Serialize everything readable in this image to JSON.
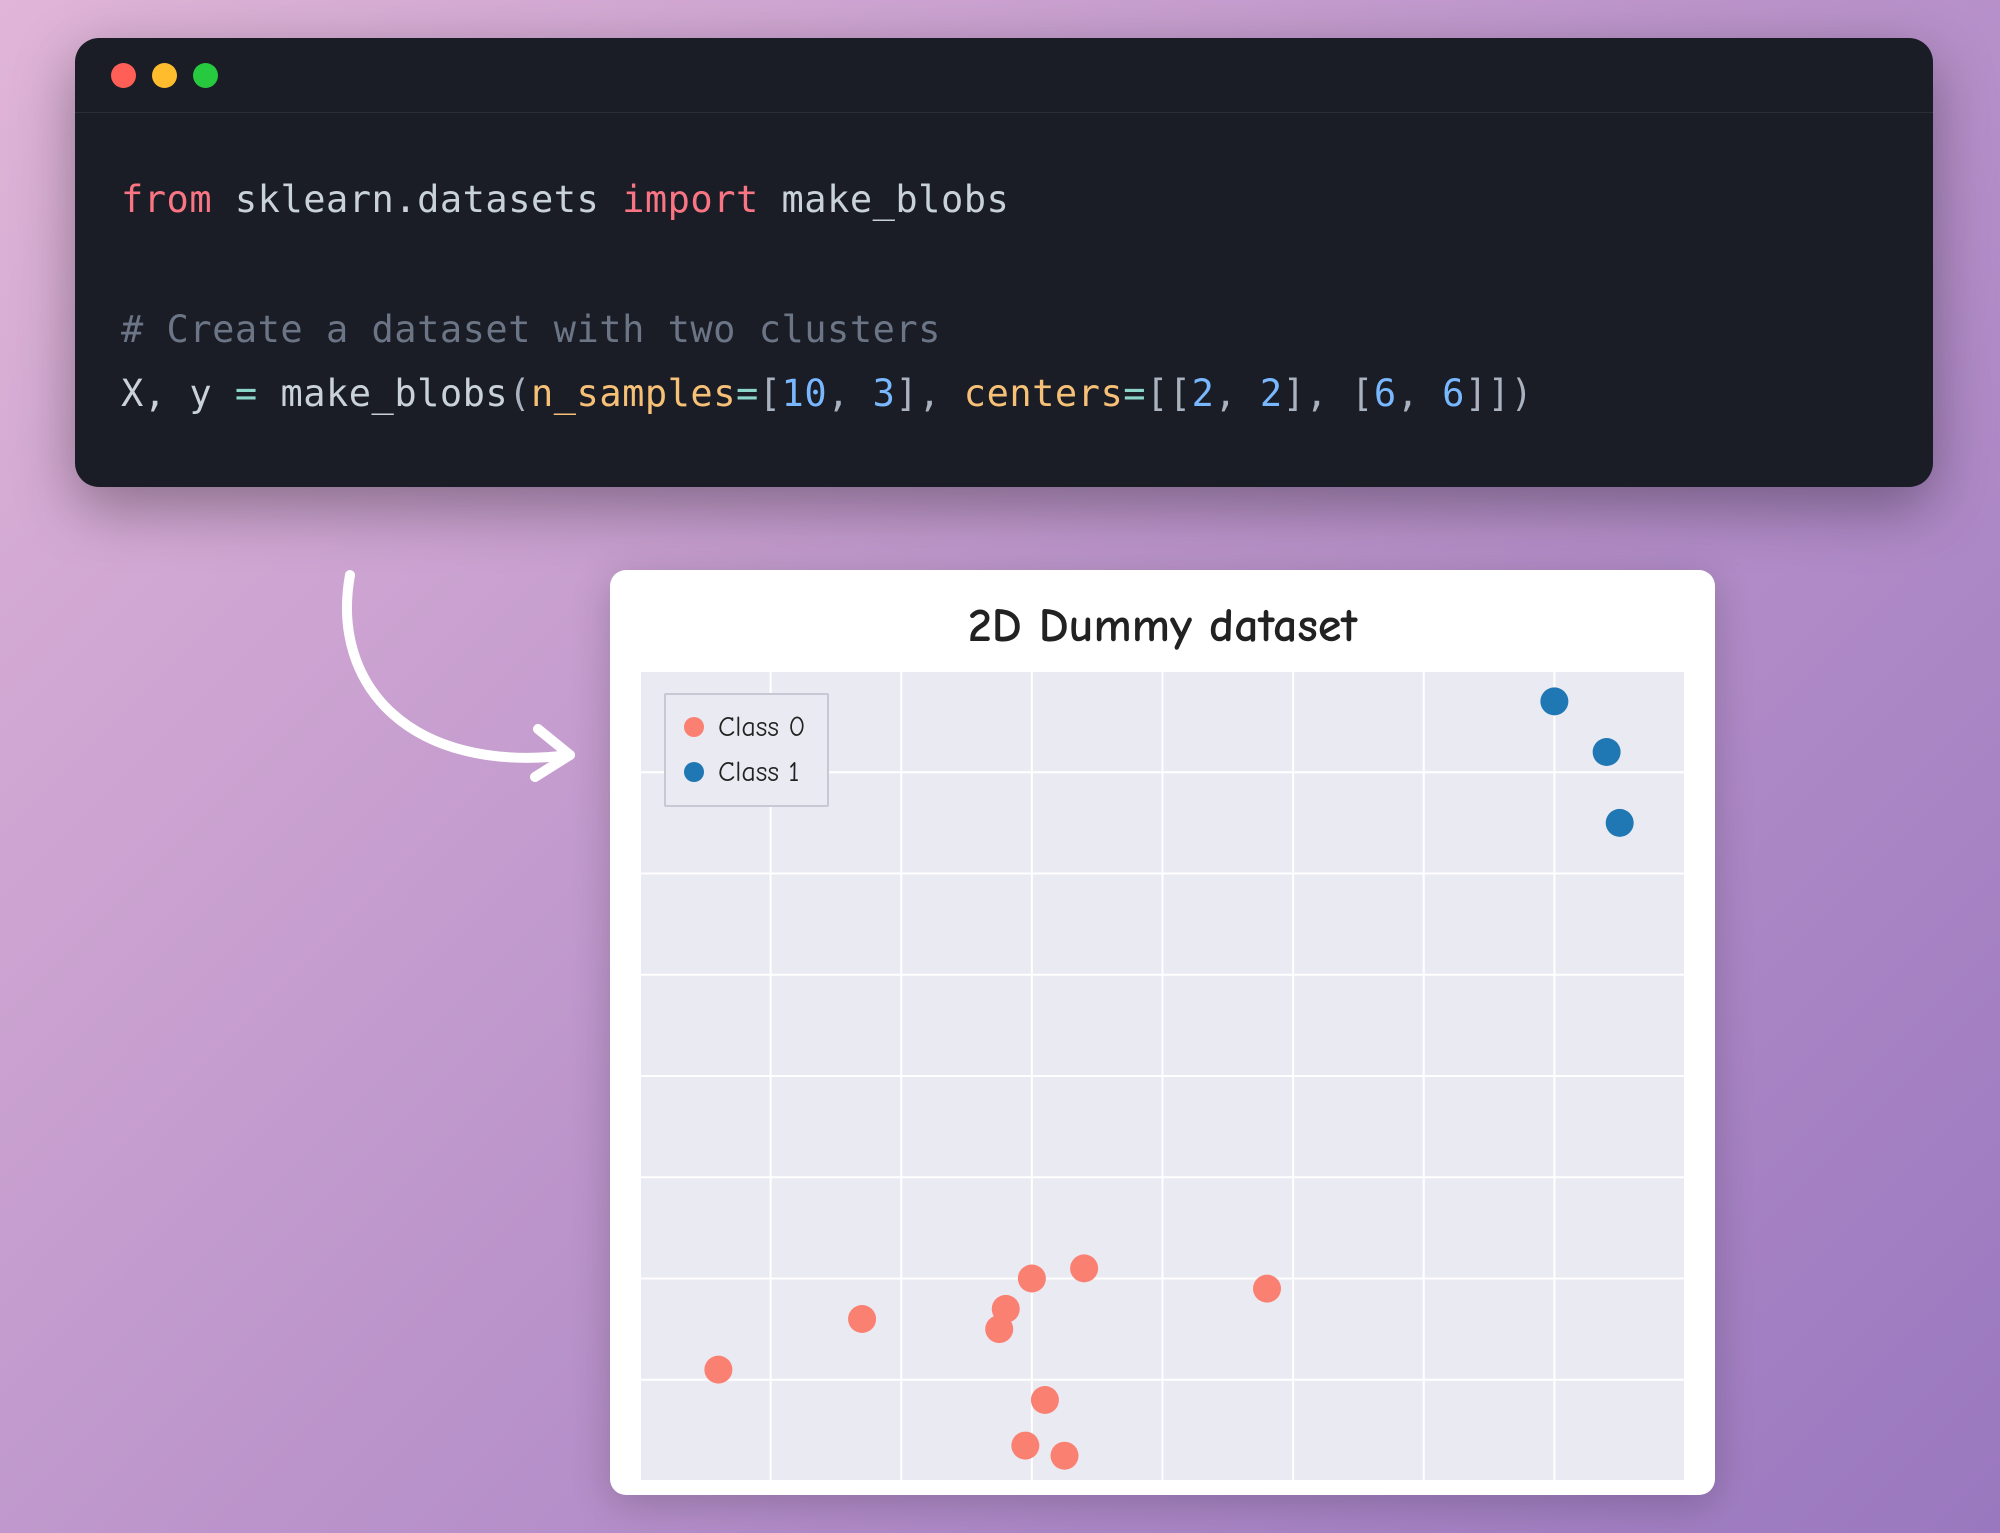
{
  "code": {
    "line1": {
      "from": "from",
      "module": "sklearn.datasets",
      "import_kw": "import",
      "name": "make_blobs"
    },
    "comment": "# Create a dataset with two clusters",
    "line3": {
      "lhs": "X, y",
      "eq": "=",
      "fn": "make_blobs",
      "p1_name": "n_samples",
      "p1_eq": "=",
      "p1_open": "[",
      "p1_a": "10",
      "p1_comma": ", ",
      "p1_b": "3",
      "p1_close": "]",
      "mid_comma": ", ",
      "p2_name": "centers",
      "p2_eq": "=",
      "p2_open": "[[",
      "p2_a": "2",
      "p2_c1": ", ",
      "p2_b": "2",
      "p2_mid": "], [",
      "p2_c": "6",
      "p2_c2": ", ",
      "p2_d": "6",
      "p2_close": "]]",
      "paren_close": ")"
    }
  },
  "legend_labels": [
    "Class 0",
    "Class 1"
  ],
  "colors": {
    "class0": "#fa8072",
    "class1": "#1f77b4",
    "grid": "#ffffff",
    "plot_bg": "#eaeaf2"
  },
  "chart_data": {
    "type": "scatter",
    "title": "2D Dummy dataset",
    "xlabel": "",
    "ylabel": "",
    "xlim": [
      0,
      8
    ],
    "ylim": [
      0,
      8
    ],
    "grid": true,
    "legend_position": "upper left",
    "series": [
      {
        "name": "Class 0",
        "color": "#fa8072",
        "points": [
          {
            "x": 0.6,
            "y": 1.1
          },
          {
            "x": 1.7,
            "y": 1.6
          },
          {
            "x": 2.8,
            "y": 1.7
          },
          {
            "x": 2.75,
            "y": 1.5
          },
          {
            "x": 3.0,
            "y": 2.0
          },
          {
            "x": 3.4,
            "y": 2.1
          },
          {
            "x": 3.1,
            "y": 0.8
          },
          {
            "x": 2.95,
            "y": 0.35
          },
          {
            "x": 3.25,
            "y": 0.25
          },
          {
            "x": 4.8,
            "y": 1.9
          }
        ]
      },
      {
        "name": "Class 1",
        "color": "#1f77b4",
        "points": [
          {
            "x": 7.0,
            "y": 7.7
          },
          {
            "x": 7.4,
            "y": 7.2
          },
          {
            "x": 7.5,
            "y": 6.5
          }
        ]
      }
    ]
  }
}
